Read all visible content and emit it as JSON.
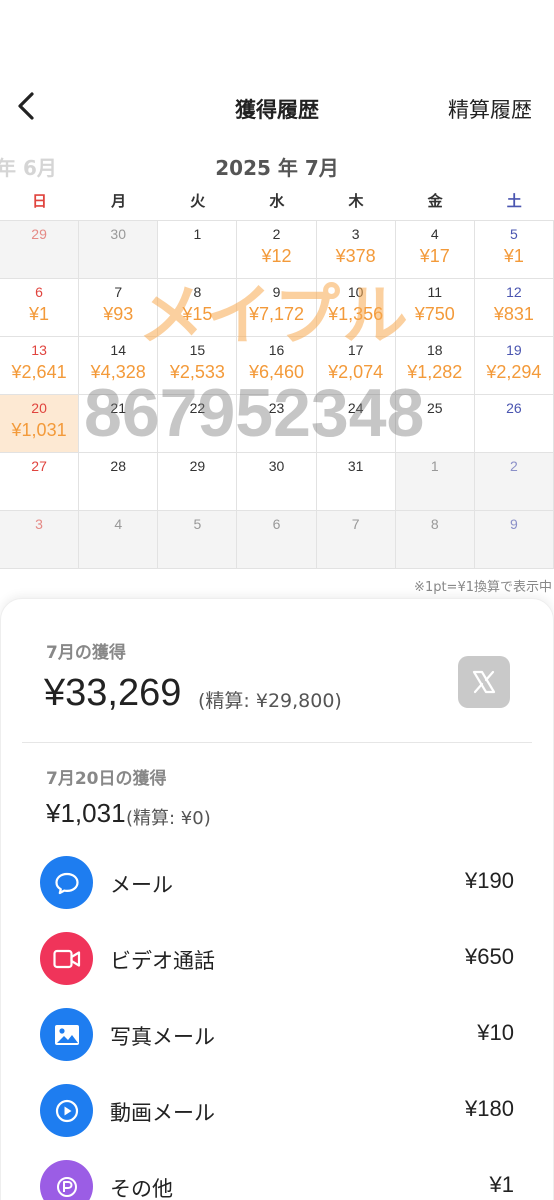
{
  "header": {
    "title": "獲得履歴",
    "right_link": "精算履歴"
  },
  "month_bar": {
    "prev": "年 6月",
    "current": "2025 年 7月"
  },
  "weekdays": [
    "日",
    "月",
    "火",
    "水",
    "木",
    "金",
    "土"
  ],
  "calendar": [
    {
      "day": "29",
      "amount": "",
      "other": true
    },
    {
      "day": "30",
      "amount": "",
      "other": true
    },
    {
      "day": "1",
      "amount": ""
    },
    {
      "day": "2",
      "amount": "¥12"
    },
    {
      "day": "3",
      "amount": "¥378"
    },
    {
      "day": "4",
      "amount": "¥17"
    },
    {
      "day": "5",
      "amount": "¥1"
    },
    {
      "day": "6",
      "amount": "¥1"
    },
    {
      "day": "7",
      "amount": "¥93"
    },
    {
      "day": "8",
      "amount": "¥15"
    },
    {
      "day": "9",
      "amount": "¥7,172"
    },
    {
      "day": "10",
      "amount": "¥1,356"
    },
    {
      "day": "11",
      "amount": "¥750"
    },
    {
      "day": "12",
      "amount": "¥831"
    },
    {
      "day": "13",
      "amount": "¥2,641"
    },
    {
      "day": "14",
      "amount": "¥4,328"
    },
    {
      "day": "15",
      "amount": "¥2,533"
    },
    {
      "day": "16",
      "amount": "¥6,460"
    },
    {
      "day": "17",
      "amount": "¥2,074"
    },
    {
      "day": "18",
      "amount": "¥1,282"
    },
    {
      "day": "19",
      "amount": "¥2,294"
    },
    {
      "day": "20",
      "amount": "¥1,031",
      "selected": true
    },
    {
      "day": "21",
      "amount": ""
    },
    {
      "day": "22",
      "amount": ""
    },
    {
      "day": "23",
      "amount": ""
    },
    {
      "day": "24",
      "amount": ""
    },
    {
      "day": "25",
      "amount": ""
    },
    {
      "day": "26",
      "amount": ""
    },
    {
      "day": "27",
      "amount": ""
    },
    {
      "day": "28",
      "amount": ""
    },
    {
      "day": "29",
      "amount": ""
    },
    {
      "day": "30",
      "amount": ""
    },
    {
      "day": "31",
      "amount": ""
    },
    {
      "day": "1",
      "amount": "",
      "other": true
    },
    {
      "day": "2",
      "amount": "",
      "other": true
    },
    {
      "day": "3",
      "amount": "",
      "other": true
    },
    {
      "day": "4",
      "amount": "",
      "other": true
    },
    {
      "day": "5",
      "amount": "",
      "other": true
    },
    {
      "day": "6",
      "amount": "",
      "other": true
    },
    {
      "day": "7",
      "amount": "",
      "other": true
    },
    {
      "day": "8",
      "amount": "",
      "other": true
    },
    {
      "day": "9",
      "amount": "",
      "other": true
    }
  ],
  "watermark": {
    "text": "メイプル",
    "number": "867952348"
  },
  "note": "※1pt=¥1換算で表示中",
  "summary": {
    "month_label": "7月の獲得",
    "month_total": "¥33,269",
    "month_settled": "(精算: ¥29,800)",
    "day_label": "7月20日の獲得",
    "day_total": "¥1,031",
    "day_settled": "(精算: ¥0)"
  },
  "breakdown": [
    {
      "label": "メール",
      "value": "¥190",
      "icon": "chat-bubble-icon",
      "color": "#1e7df0"
    },
    {
      "label": "ビデオ通話",
      "value": "¥650",
      "icon": "video-camera-icon",
      "color": "#f0345a"
    },
    {
      "label": "写真メール",
      "value": "¥10",
      "icon": "image-icon",
      "color": "#1e7df0"
    },
    {
      "label": "動画メール",
      "value": "¥180",
      "icon": "play-icon",
      "color": "#1e7df0"
    },
    {
      "label": "その他",
      "value": "¥1",
      "icon": "points-icon",
      "color": "#9b5de5"
    }
  ]
}
